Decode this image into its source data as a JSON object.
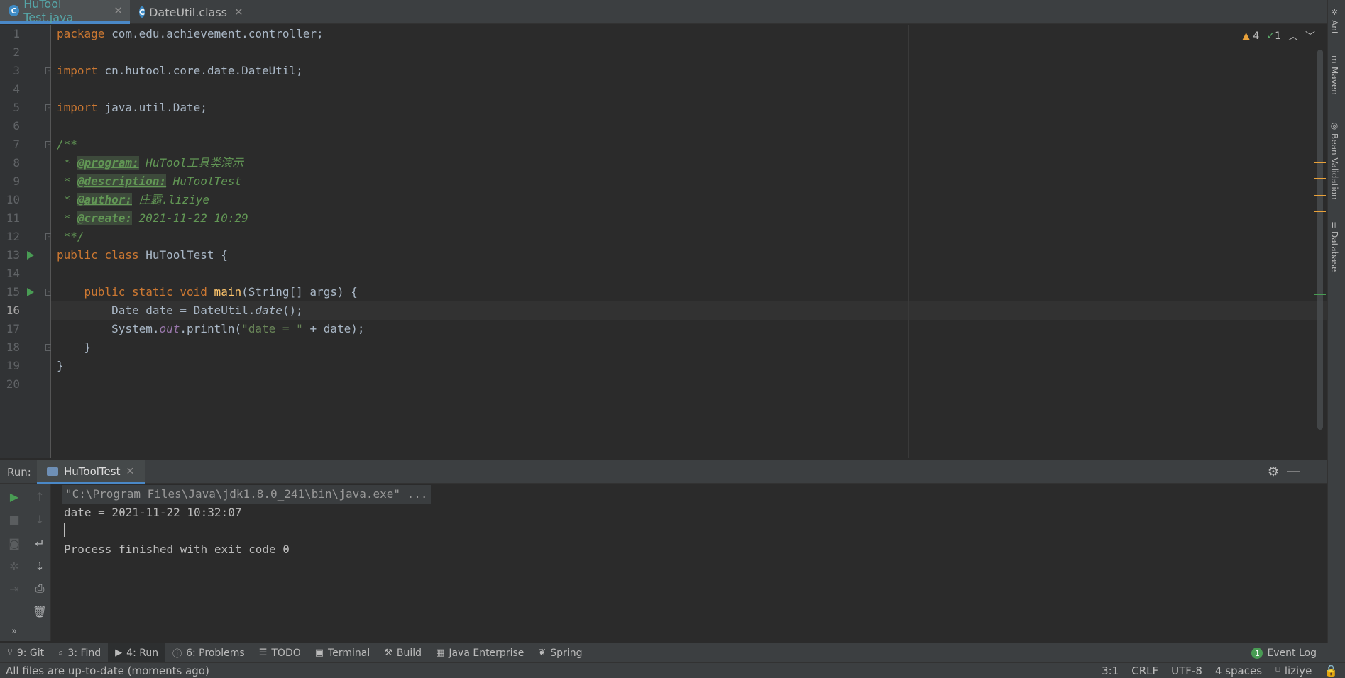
{
  "tabs": [
    {
      "label": "HuTool​Test.java",
      "icon": "class-c-icon"
    },
    {
      "label": "DateUtil.class",
      "icon": "class-c-icon"
    }
  ],
  "right_tools": [
    "Ant",
    "Maven",
    "Bean Validation",
    "Database"
  ],
  "inspection": {
    "warnings": "4",
    "ok": "1"
  },
  "line_numbers": [
    "1",
    "2",
    "3",
    "4",
    "5",
    "6",
    "7",
    "8",
    "9",
    "10",
    "11",
    "12",
    "13",
    "14",
    "15",
    "16",
    "17",
    "18",
    "19",
    "20"
  ],
  "code": {
    "l1_kw": "package",
    "l1_rest": " com.edu.achievement.controller;",
    "l3_kw": "import",
    "l3_rest": " cn.hutool.core.date.DateUtil;",
    "l5_kw": "import",
    "l5_rest": " java.util.Date;",
    "l7": "/**",
    "l8_star": " * ",
    "l8_tag": "@program:",
    "l8_val": " HuTool工具类演示",
    "l9_star": " * ",
    "l9_tag": "@description:",
    "l9_val": " HuToolTest",
    "l10_star": " * ",
    "l10_tag": "@author:",
    "l10_val": " 庄霸.liziye",
    "l11_star": " * ",
    "l11_tag": "@create:",
    "l11_val": " 2021-11-22 10:29",
    "l12": " **/",
    "l13_kw": "public class",
    "l13_rest": " HuToolTest {",
    "l15_kw": "    public static void",
    "l15_fn": " main",
    "l15_rest": "(String[] args) {",
    "l16_a": "        Date date = DateUtil.",
    "l16_m": "date",
    "l16_b": "();",
    "l17_a": "        System.",
    "l17_s": "out",
    "l17_b": ".println(",
    "l17_str": "\"date = \"",
    "l17_c": " + date);",
    "l18": "    }",
    "l19": "}"
  },
  "run": {
    "label": "Run:",
    "tab": "HuToolTest",
    "console": [
      "\"C:\\Program Files\\Java\\jdk1.8.0_241\\bin\\java.exe\" ...",
      "date = 2021-11-22 10:32:07",
      "",
      "Process finished with exit code 0"
    ]
  },
  "bottom_tools": [
    {
      "label": "9: Git",
      "icon": "git-branch-icon"
    },
    {
      "label": "3: Find",
      "icon": "search-icon"
    },
    {
      "label": "4: Run",
      "icon": "play-icon"
    },
    {
      "label": "6: Problems",
      "icon": "info-icon"
    },
    {
      "label": "TODO",
      "icon": "list-icon"
    },
    {
      "label": "Terminal",
      "icon": "terminal-icon"
    },
    {
      "label": "Build",
      "icon": "hammer-icon"
    },
    {
      "label": "Java Enterprise",
      "icon": "enterprise-icon"
    },
    {
      "label": "Spring",
      "icon": "leaf-icon"
    }
  ],
  "event_log": {
    "label": "Event Log",
    "count": "1"
  },
  "status": {
    "message": "All files are up-to-date (moments ago)",
    "position": "3:1",
    "line_sep": "CRLF",
    "encoding": "UTF-8",
    "indent": "4 spaces",
    "branch": "liziye"
  },
  "colors": {
    "accent": "#4a88c7",
    "run_green": "#499c54",
    "warning": "#e8a13a"
  }
}
